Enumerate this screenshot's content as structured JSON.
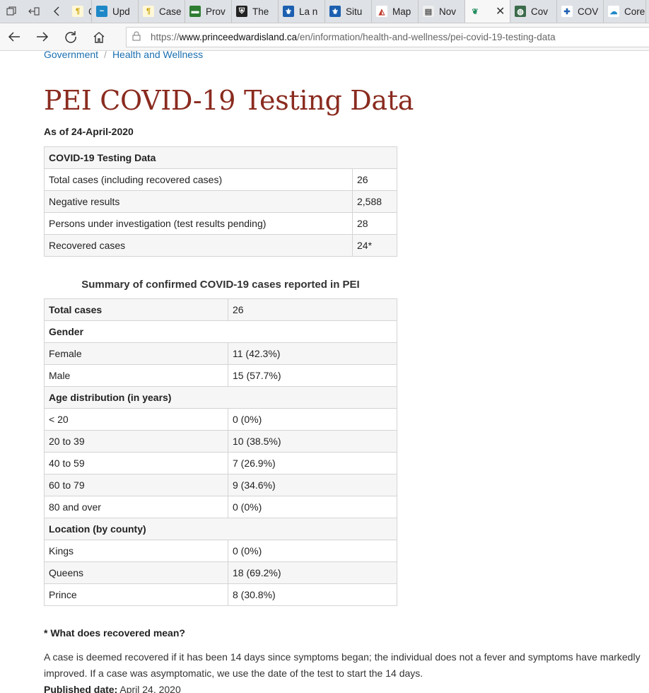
{
  "browser": {
    "tabs": [
      {
        "label": "Case",
        "icon": "document-icon"
      },
      {
        "label": "Upd",
        "icon": "blue-chart-icon"
      },
      {
        "label": "Case",
        "icon": "document-icon"
      },
      {
        "label": "Prov",
        "icon": "green-flag-icon"
      },
      {
        "label": "The",
        "icon": "shield-icon"
      },
      {
        "label": "La n",
        "icon": "fleur-de-lis-icon"
      },
      {
        "label": "Situ",
        "icon": "fleur-de-lis-icon"
      },
      {
        "label": "Map",
        "icon": "map-icon"
      },
      {
        "label": "Nov",
        "icon": "image-icon"
      },
      {
        "label": "",
        "icon": "pei-icon",
        "active": true
      },
      {
        "label": "Cov",
        "icon": "globe-icon"
      },
      {
        "label": "COV",
        "icon": "health-icon"
      },
      {
        "label": "Core",
        "icon": "cloud-icon"
      }
    ],
    "url_scheme": "https://",
    "url_host": "www.princeedwardisland.ca",
    "url_path": "/en/information/health-and-wellness/pei-covid-19-testing-data"
  },
  "breadcrumb": {
    "items": [
      "Government",
      "Health and Wellness"
    ],
    "separator": "/"
  },
  "page": {
    "title": "PEI COVID-19 Testing Data",
    "as_of": "As of 24-April-2020"
  },
  "testing_table": {
    "header": "COVID-19 Testing Data",
    "rows": [
      {
        "label": "Total cases (including recovered cases)",
        "value": "26"
      },
      {
        "label": "Negative results",
        "value": "2,588"
      },
      {
        "label": "Persons under investigation (test results pending)",
        "value": "28"
      },
      {
        "label": "Recovered cases",
        "value": "24*"
      }
    ]
  },
  "summary_table": {
    "caption": "Summary of confirmed COVID-19 cases reported in PEI",
    "total_label": "Total cases",
    "total_value": "26",
    "gender_heading": "Gender",
    "gender": [
      {
        "label": "Female",
        "value": "11 (42.3%)"
      },
      {
        "label": "Male",
        "value": "15 (57.7%)"
      }
    ],
    "age_heading": "Age distribution (in years)",
    "age": [
      {
        "label": "< 20",
        "value": "0 (0%)"
      },
      {
        "label": "20 to 39",
        "value": "10 (38.5%)"
      },
      {
        "label": "40 to 59",
        "value": "7 (26.9%)"
      },
      {
        "label": "60 to 79",
        "value": "9 (34.6%)"
      },
      {
        "label": "80 and over",
        "value": "0 (0%)"
      }
    ],
    "location_heading": "Location (by county)",
    "location": [
      {
        "label": "Kings",
        "value": "0 (0%)"
      },
      {
        "label": "Queens",
        "value": "18 (69.2%)"
      },
      {
        "label": "Prince",
        "value": "8 (30.8%)"
      }
    ]
  },
  "recovered_note": {
    "question": "* What does recovered mean?",
    "answer": "A case is deemed recovered if it has been 14 days since symptoms began; the individual does not a fever and symptoms have markedly improved. If a case was asymptomatic, we use the date of the test to start the 14 days.",
    "published_label": "Published date:",
    "published_value": "April 24, 2020"
  },
  "colors": {
    "title": "#8a2b1f",
    "link": "#1a6fb0",
    "table_border": "#d4d4d4",
    "alt_row": "#f6f6f6"
  }
}
